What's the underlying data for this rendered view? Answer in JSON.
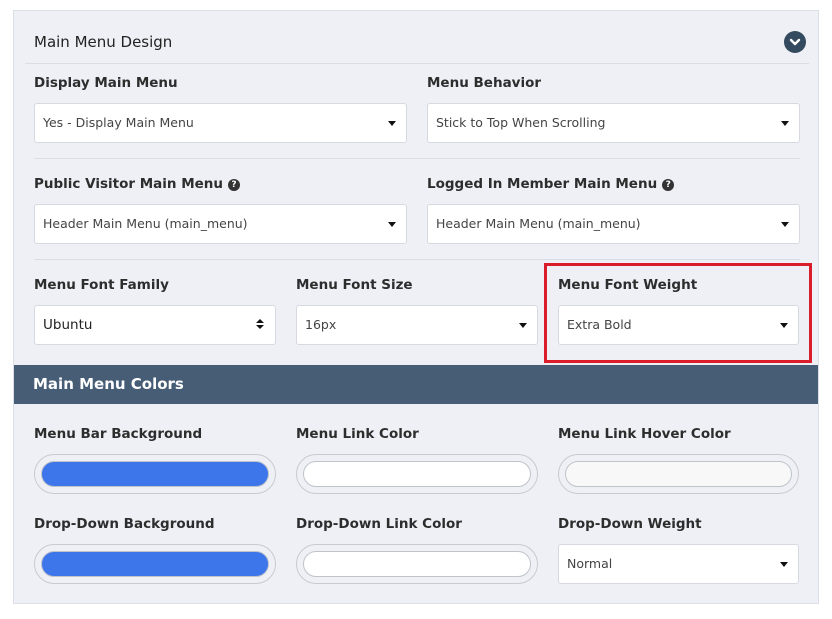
{
  "design": {
    "title": "Main Menu Design",
    "display_main_menu": {
      "label": "Display Main Menu",
      "value": "Yes - Display Main Menu"
    },
    "menu_behavior": {
      "label": "Menu Behavior",
      "value": "Stick to Top When Scrolling"
    },
    "public_visitor_menu": {
      "label": "Public Visitor Main Menu",
      "value": "Header Main Menu (main_menu)"
    },
    "logged_in_menu": {
      "label": "Logged In Member Main Menu",
      "value": "Header Main Menu (main_menu)"
    },
    "font_family": {
      "label": "Menu Font Family",
      "value": "Ubuntu"
    },
    "font_size": {
      "label": "Menu Font Size",
      "value": "16px"
    },
    "font_weight": {
      "label": "Menu Font Weight",
      "value": "Extra Bold"
    },
    "help_glyph": "?"
  },
  "colors": {
    "title": "Main Menu Colors",
    "bar_background": {
      "label": "Menu Bar Background",
      "color": "#3d75ea"
    },
    "link_color": {
      "label": "Menu Link Color",
      "color": "#ffffff"
    },
    "link_hover_color": {
      "label": "Menu Link Hover Color",
      "color": "#f8f8f8"
    },
    "dropdown_background": {
      "label": "Drop-Down Background",
      "color": "#3d75ea"
    },
    "dropdown_link_color": {
      "label": "Drop-Down Link Color",
      "color": "#ffffff"
    },
    "dropdown_weight": {
      "label": "Drop-Down Weight",
      "value": "Normal"
    }
  },
  "style": {
    "highlight_color": "#d91d2a",
    "header_bar_color": "#465d75",
    "collapse_icon": "chevron-down-icon"
  }
}
